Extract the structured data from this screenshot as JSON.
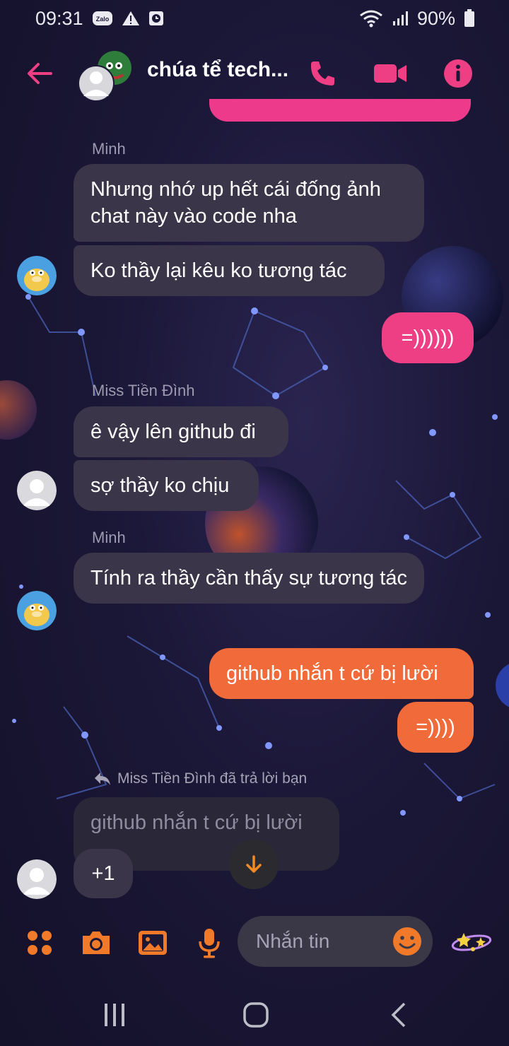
{
  "status_bar": {
    "time": "09:31",
    "notif_app": "Zalo",
    "battery": "90%"
  },
  "header": {
    "title": "chúa tể tech..."
  },
  "messages": [
    {
      "sender": "Minh",
      "lines": [
        "Nhưng nhớ up hết cái đống ảnh chat này vào code nha",
        "Ko thầy lại kêu ko tương tác"
      ]
    },
    {
      "self": "=))))))"
    },
    {
      "sender": "Miss Tiền Đình",
      "lines": [
        "ê vậy lên github đi",
        "sợ thầy ko chịu"
      ]
    },
    {
      "sender": "Minh",
      "lines": [
        "Tính ra thầy cần thấy sự tương tác"
      ]
    },
    {
      "self_lines": [
        "github nhắn t cứ bị lười",
        "=))))"
      ]
    }
  ],
  "reply": {
    "note": "Miss Tiền Đình đã trả lời bạn",
    "quoted": "github nhắn t cứ bị lười",
    "text": "+1"
  },
  "composer": {
    "placeholder": "Nhắn tin"
  },
  "colors": {
    "accent_pink": "#ee3f85",
    "accent_orange": "#f06a3a",
    "bubble_in": "#3a3548"
  }
}
